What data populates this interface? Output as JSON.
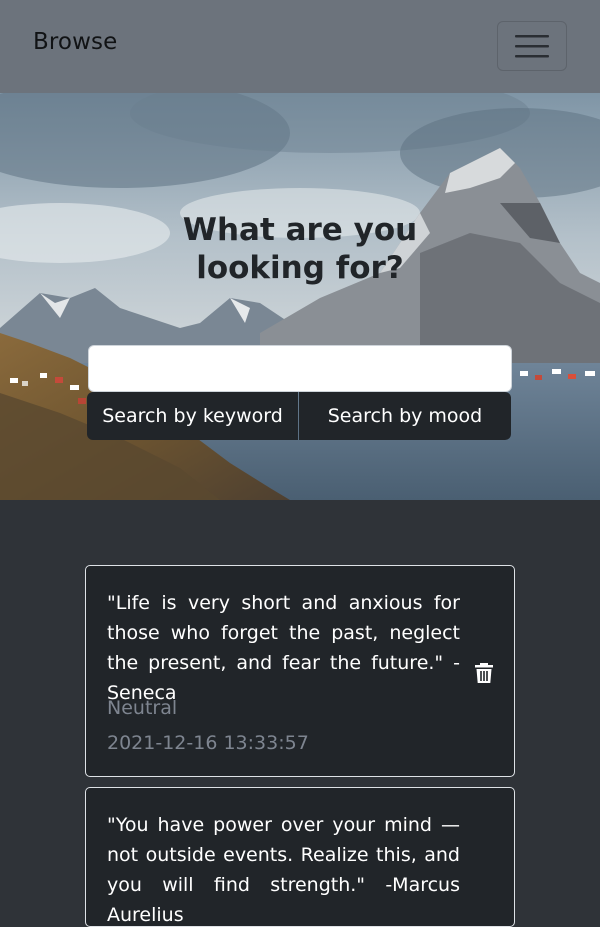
{
  "navbar": {
    "brand": "Browse",
    "menu_icon": "hamburger-menu-icon"
  },
  "hero": {
    "title": "What are you looking for?",
    "search": {
      "value": "",
      "placeholder": ""
    },
    "buttons": {
      "keyword": "Search by keyword",
      "mood": "Search by mood"
    }
  },
  "quotes": [
    {
      "text": "\"Life is very short and anxious for those who forget the past, neglect the present, and fear the future.\" -Seneca",
      "mood": "Neutral",
      "timestamp": "2021-12-16 13:33:57",
      "delete_icon": "trash-icon"
    },
    {
      "text": "\"You have power over your mind — not outside events. Realize this, and you will find strength.\" -Marcus Aurelius"
    }
  ],
  "colors": {
    "navbar_bg": "#6c737c",
    "page_bg": "#2f3338",
    "card_bg": "#212529",
    "button_bg": "#212529",
    "muted_text": "#7e8590"
  }
}
